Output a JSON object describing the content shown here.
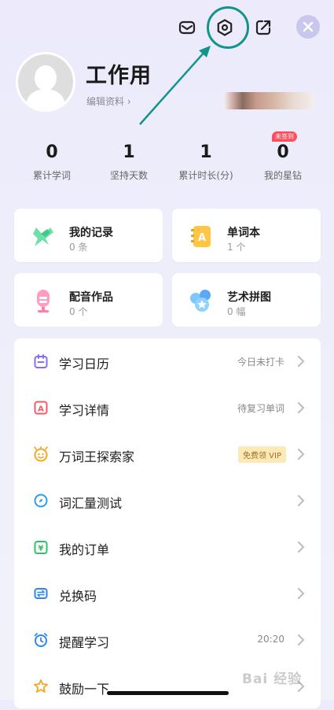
{
  "header": {
    "icons": [
      "mail-icon",
      "settings-icon",
      "share-icon",
      "close-icon"
    ]
  },
  "profile": {
    "name": "工作用",
    "edit_label": "编辑资料 ›"
  },
  "stats": [
    {
      "value": "0",
      "label": "累计学词"
    },
    {
      "value": "1",
      "label": "坚持天数"
    },
    {
      "value": "1",
      "label": "累计时长(分)"
    },
    {
      "value": "0",
      "label": "我的星钻",
      "badge": "未签到"
    }
  ],
  "cards": [
    {
      "title": "我的记录",
      "sub": "0 条",
      "icon": "pin-icon"
    },
    {
      "title": "单词本",
      "sub": "1 个",
      "icon": "notebook-icon"
    },
    {
      "title": "配音作品",
      "sub": "0 个",
      "icon": "microphone-icon"
    },
    {
      "title": "艺术拼图",
      "sub": "0 幅",
      "icon": "puzzle-icon"
    }
  ],
  "menu": [
    {
      "label": "学习日历",
      "right": "今日未打卡",
      "icon": "calendar-icon"
    },
    {
      "label": "学习详情",
      "right": "待复习单词",
      "icon": "detail-icon"
    },
    {
      "label": "万词王探索家",
      "vip": "免费领 VIP",
      "icon": "explorer-icon"
    },
    {
      "label": "词汇量测试",
      "right": "",
      "icon": "compass-icon"
    },
    {
      "label": "我的订单",
      "right": "",
      "icon": "order-icon"
    },
    {
      "label": "兑换码",
      "right": "",
      "icon": "exchange-icon"
    },
    {
      "label": "提醒学习",
      "right": "20:20",
      "icon": "alarm-icon"
    },
    {
      "label": "鼓励一下",
      "right": "",
      "icon": "star-icon"
    }
  ],
  "watermark": "Bai 经验",
  "colors": {
    "accent": "#11958a",
    "badge": "#ff4d5b",
    "close_bg": "#c9c7ee"
  }
}
